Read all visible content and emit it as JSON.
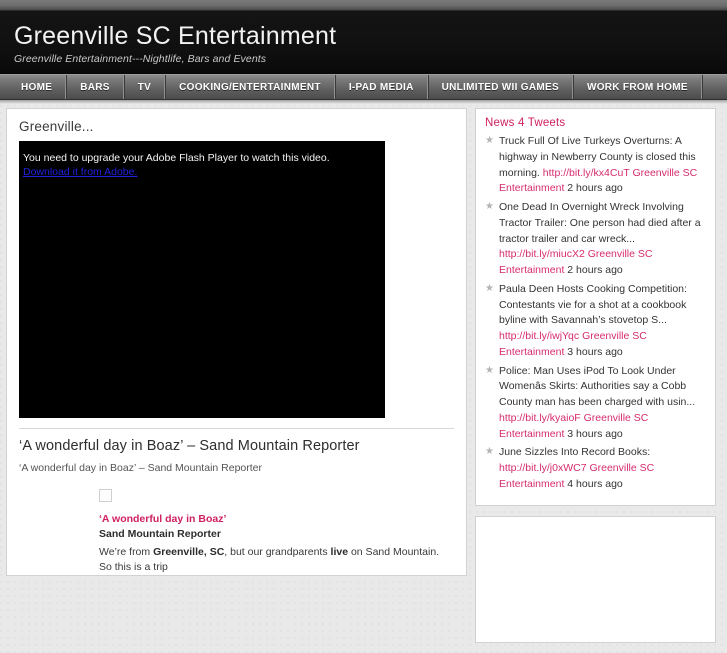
{
  "site": {
    "title": "Greenville SC Entertainment",
    "description": "Greenville Entertainment---Nightlife, Bars and Events"
  },
  "nav": {
    "items": [
      {
        "label": "HOME",
        "name": "nav-item-home"
      },
      {
        "label": "BARS",
        "name": "nav-item-bars"
      },
      {
        "label": "TV",
        "name": "nav-item-tv"
      },
      {
        "label": "COOKING/ENTERTAINMENT",
        "name": "nav-item-cooking-entertainment"
      },
      {
        "label": "I-PAD MEDIA",
        "name": "nav-item-ipad-media"
      },
      {
        "label": "UNLIMITED WII GAMES",
        "name": "nav-item-unlimited-wii-games"
      },
      {
        "label": "WORK FROM HOME",
        "name": "nav-item-work-from-home"
      }
    ]
  },
  "content": {
    "post_title": "Greenville...",
    "video": {
      "message": "You need to upgrade your Adobe Flash Player to watch this video.",
      "link_label": "Download it from Adobe."
    },
    "article": {
      "heading": "‘A wonderful day in Boaz’ – Sand Mountain Reporter",
      "subheading": "‘A wonderful day in Boaz’ – Sand Mountain Reporter",
      "excerpt_title": "‘A wonderful day in Boaz’",
      "excerpt_source": "Sand Mountain Reporter",
      "excerpt_body_1": "We’re from ",
      "excerpt_bold_1": "Greenville, SC",
      "excerpt_body_2": ", but our grandparents ",
      "excerpt_bold_2": "live",
      "excerpt_body_3": " on Sand Mountain. So this is a trip"
    }
  },
  "sidebar": {
    "widget_title": "News 4 Tweets",
    "tweets": [
      {
        "text": "Truck Full Of Live Turkeys Overturns: A highway in Newberry County is closed this morning. ",
        "link": "http://bit.ly/kx4CuT Greenville SC Entertainment",
        "time": " 2 hours ago"
      },
      {
        "text": "One Dead In Overnight Wreck Involving Tractor Trailer: One person had died after a tractor trailer and car wreck... ",
        "link": "http://bit.ly/miucX2 Greenville SC Entertainment",
        "time": " 2 hours ago"
      },
      {
        "text": "Paula Deen Hosts Cooking Competition: Contestants vie for a shot at a cookbook byline with Savannah’s stovetop S... ",
        "link": "http://bit.ly/iwjYqc Greenville SC Entertainment",
        "time": " 3 hours ago"
      },
      {
        "text": "Police: Man Uses iPod To Look Under Womenâs Skirts: Authorities say a Cobb County man has been charged with usin... ",
        "link": "http://bit.ly/kyaioF Greenville SC Entertainment",
        "time": " 3 hours ago"
      },
      {
        "text": "June Sizzles Into Record Books: ",
        "link": "http://bit.ly/j0xWC7 Greenville SC Entertainment",
        "time": " 4 hours ago"
      }
    ]
  },
  "colors": {
    "accent_pink": "#d62b6d",
    "header_black": "#111111",
    "nav_gray": "#6e6e6e",
    "page_bg": "#e9e9e9",
    "video_link_blue": "#2121dd"
  }
}
